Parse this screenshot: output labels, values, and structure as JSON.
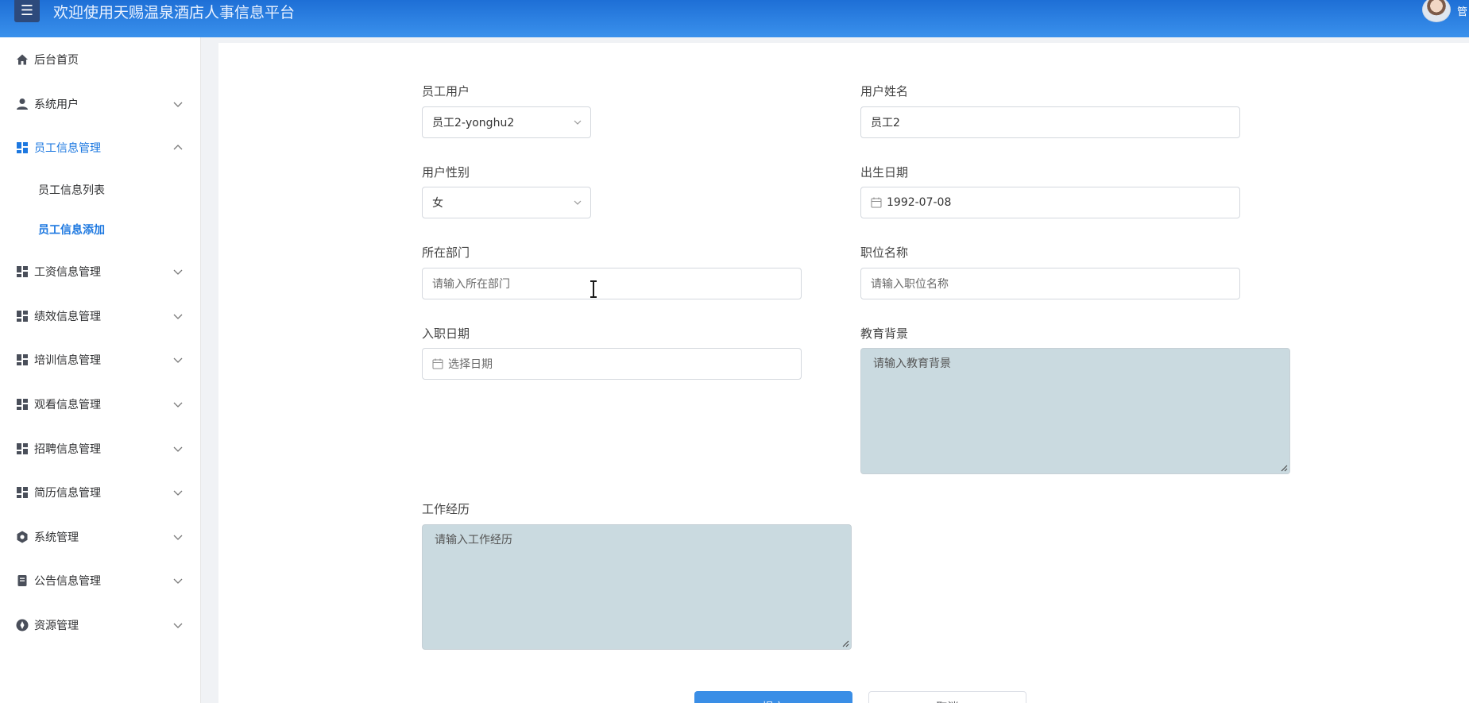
{
  "header": {
    "menu_icon": "hamburger-icon",
    "title": "欢迎使用天赐温泉酒店人事信息平台",
    "user_name": "管"
  },
  "sidebar": {
    "items": [
      {
        "label": "后台首页",
        "icon": "home-icon"
      },
      {
        "label": "系统用户",
        "icon": "user-icon"
      },
      {
        "label": "员工信息管理",
        "icon": "grid-icon"
      },
      {
        "label": "工资信息管理",
        "icon": "grid-icon"
      },
      {
        "label": "绩效信息管理",
        "icon": "grid-icon"
      },
      {
        "label": "培训信息管理",
        "icon": "grid-icon"
      },
      {
        "label": "观看信息管理",
        "icon": "grid-icon"
      },
      {
        "label": "招聘信息管理",
        "icon": "grid-icon"
      },
      {
        "label": "简历信息管理",
        "icon": "grid-icon"
      },
      {
        "label": "系统管理",
        "icon": "gear-icon"
      },
      {
        "label": "公告信息管理",
        "icon": "document-icon"
      },
      {
        "label": "资源管理",
        "icon": "compass-icon"
      }
    ],
    "sub_items": [
      {
        "label": "员工信息列表"
      },
      {
        "label": "员工信息添加"
      }
    ],
    "accent_color": "#1d78e0"
  },
  "form": {
    "employee_user": {
      "label": "员工用户",
      "value": "员工2-yonghu2"
    },
    "user_name": {
      "label": "用户姓名",
      "value": "员工2"
    },
    "gender": {
      "label": "用户性别",
      "value": "女"
    },
    "birth_date": {
      "label": "出生日期",
      "value": "1992-07-08"
    },
    "department": {
      "label": "所在部门",
      "placeholder": "请输入所在部门"
    },
    "position": {
      "label": "职位名称",
      "placeholder": "请输入职位名称"
    },
    "hire_date": {
      "label": "入职日期",
      "placeholder": "选择日期"
    },
    "education": {
      "label": "教育背景",
      "placeholder": "请输入教育背景"
    },
    "work_history": {
      "label": "工作经历",
      "placeholder": "请输入工作经历"
    }
  },
  "buttons": {
    "submit_label": "提交",
    "cancel_label": "取消"
  }
}
